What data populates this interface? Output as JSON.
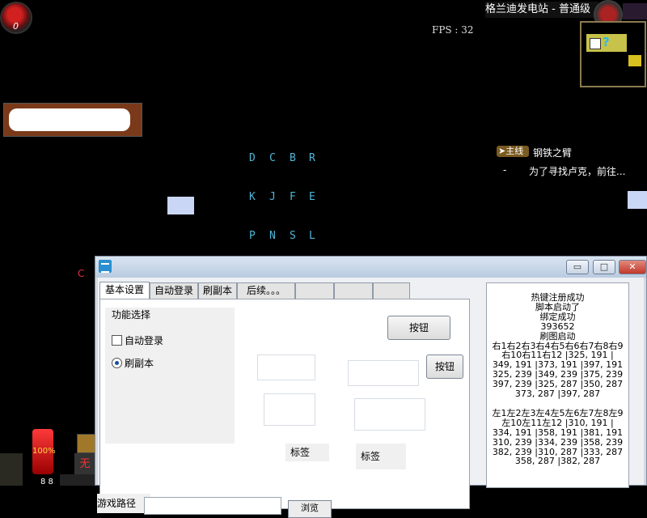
{
  "game": {
    "server_title": "格兰迪发电站 - 普通级",
    "player_level": "0",
    "emblem_level": "0",
    "fps_label": "FPS : 32",
    "glyph_rows": [
      [
        "D",
        "C",
        "B",
        "R"
      ],
      [
        "K",
        "J",
        "F",
        "E"
      ],
      [
        "P",
        "N",
        "S",
        "L"
      ]
    ],
    "quest": {
      "badge": "主线",
      "title": "钢铁之臂",
      "dash": "-",
      "desc": "为了寻找卢克，前往..."
    },
    "c_mark": "C",
    "hp_percent": "100%",
    "wu_label": "无",
    "small_number": "8 8"
  },
  "window": {
    "buttons": {
      "min": "▭",
      "max": "□",
      "close": "✕"
    },
    "tabs": [
      "基本设置",
      "自动登录",
      "刷副本",
      "后续。。。",
      "",
      "",
      ""
    ],
    "group_title": "功能选择",
    "options": [
      {
        "label": "自动登录",
        "type": "checkbox",
        "checked": false
      },
      {
        "label": "刷副本",
        "type": "radio",
        "checked": true
      }
    ],
    "button_1": "按钮",
    "button_2": "按钮",
    "label_1": "标签",
    "label_2": "标签",
    "path_label": "游戏路径",
    "browse_label": "浏览",
    "log_lines": [
      "热键注册成功",
      "脚本启动了",
      "绑定成功",
      "393652",
      "刷图启动",
      "右1右2右3右4右5右6右7右8右9",
      "右10右11右12 |325, 191 |",
      "349, 191 |373, 191 |397, 191",
      "325, 239 |349, 239 |375, 239",
      "397, 239 |325, 287 |350, 287",
      "373, 287 |397, 287",
      "",
      "左1左2左3左4左5左6左7左8左9",
      "左10左11左12 |310, 191 |",
      "334, 191 |358, 191 |381, 191",
      "310, 239 |334, 239 |358, 239",
      "382, 239 |310, 287 |333, 287",
      "358, 287 |382, 287"
    ]
  }
}
